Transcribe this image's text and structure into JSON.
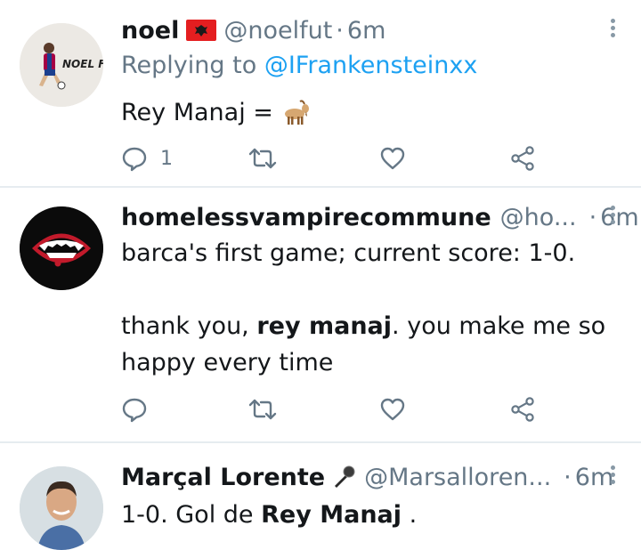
{
  "tweets": [
    {
      "name": "noel",
      "handle": "@noelfut",
      "separator": "·",
      "time": "6m",
      "replying_prefix": "Replying to",
      "replying_to": "@IFrankensteinxx",
      "avatar_text": "NOEL FUT",
      "body": "Rey Manaj =",
      "reply_count": "1",
      "colors": {
        "flag": "#e41e20",
        "goat": "#a0703a"
      }
    },
    {
      "name": "homelessvampirecommune",
      "handle": "@ho...",
      "separator": "·",
      "time": "6m",
      "line1": "barca's first game; current score: 1-0.",
      "line2_start": "thank you, ",
      "line2_bold": "rey manaj",
      "line2_end": ". you make me so",
      "line3": "happy every time"
    },
    {
      "name": "Marçal Lorente",
      "handle": "@Marsalloren...",
      "separator": "·",
      "time": "6m",
      "body_start": "1-0. Gol de ",
      "body_bold": "Rey Manaj",
      "body_end": " ."
    }
  ],
  "icons": [
    "reply-icon",
    "retweet-icon",
    "like-icon",
    "share-icon",
    "more-icon"
  ],
  "colors": {
    "link": "#1da1f2",
    "muted": "#657786",
    "divider": "#e6ecf0",
    "text": "#14171a"
  }
}
